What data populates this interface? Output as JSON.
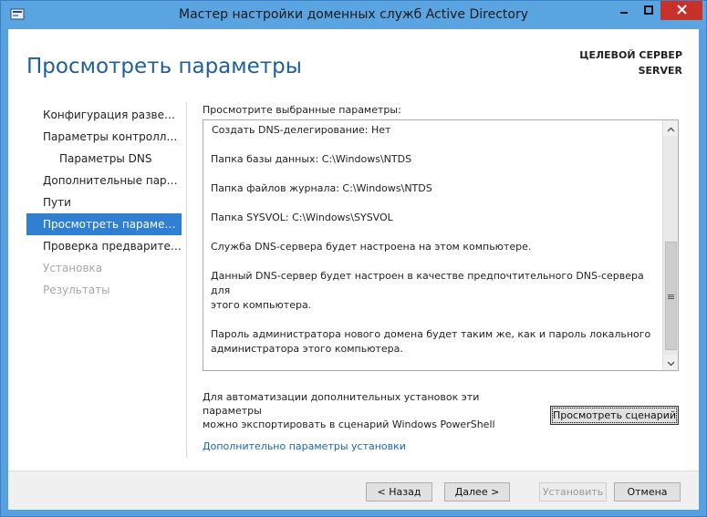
{
  "window": {
    "title": "Мастер настройки доменных служб Active Directory"
  },
  "header": {
    "page_title": "Просмотреть параметры",
    "target_label": "ЦЕЛЕВОЙ СЕРВЕР",
    "target_name": "SERVER"
  },
  "nav": {
    "items": [
      {
        "label": "Конфигурация разверты..."
      },
      {
        "label": "Параметры контроллера..."
      },
      {
        "label": "Параметры DNS"
      },
      {
        "label": "Дополнительные парам..."
      },
      {
        "label": "Пути"
      },
      {
        "label": "Просмотреть параметры"
      },
      {
        "label": "Проверка предваритель..."
      },
      {
        "label": "Установка"
      },
      {
        "label": "Результаты"
      }
    ]
  },
  "main": {
    "section_label": "Просмотрите выбранные параметры:",
    "lines": [
      "Создать DNS-делегирование: Нет",
      "Папка базы данных: C:\\Windows\\NTDS",
      "Папка файлов журнала: C:\\Windows\\NTDS",
      "Папка SYSVOL: C:\\Windows\\SYSVOL",
      "Служба DNS-сервера будет настроена на этом компьютере.",
      "Данный DNS-сервер будет настроен в качестве предпочтительного DNS-сервера для",
      "этого компьютера.",
      "Пароль администратора нового домена будет таким же, как и пароль локального",
      "администратора этого компьютера."
    ],
    "export_note_line1": "Для автоматизации дополнительных установок эти параметры",
    "export_note_line2": "можно экспортировать в сценарий Windows PowerShell",
    "view_script_label": "Просмотреть сценарий",
    "advanced_link": "Дополнительно параметры установки"
  },
  "footer": {
    "back_label": "< Назад",
    "next_label": "Далее >",
    "install_label": "Установить",
    "cancel_label": "Отмена"
  }
}
